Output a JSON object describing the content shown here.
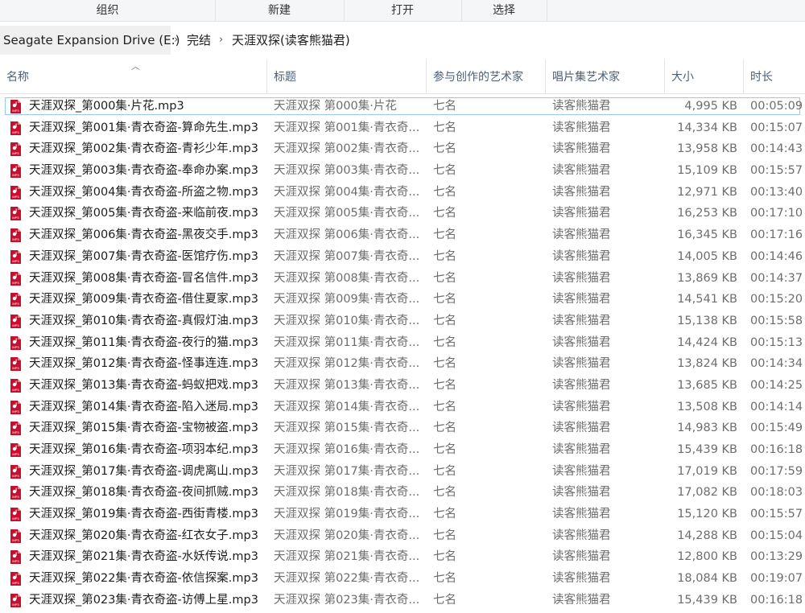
{
  "toolbar": {
    "organize": "组织",
    "new": "新建",
    "open": "打开",
    "select": "选择"
  },
  "breadcrumb": {
    "drive": "Seagate Expansion Drive (E:)",
    "folder": "完结",
    "current": "天涯双探(读客熊猫君)"
  },
  "columns": {
    "name": "名称",
    "title": "标题",
    "artist": "参与创作的艺术家",
    "album_artist": "唱片集艺术家",
    "size": "大小",
    "duration": "时长"
  },
  "icon": {
    "name": "mp3-file-icon",
    "color": "#c8102e",
    "label": "MP3"
  },
  "files": [
    {
      "name": "天涯双探_第000集·片花.mp3",
      "title": "天涯双探 第000集·片花",
      "artist": "七名",
      "album_artist": "读客熊猫君",
      "size": "4,995 KB",
      "duration": "00:05:09"
    },
    {
      "name": "天涯双探_第001集·青衣奇盗-算命先生.mp3",
      "title": "天涯双探 第001集·青衣奇...",
      "artist": "七名",
      "album_artist": "读客熊猫君",
      "size": "14,334 KB",
      "duration": "00:15:07"
    },
    {
      "name": "天涯双探_第002集·青衣奇盗-青衫少年.mp3",
      "title": "天涯双探 第002集·青衣奇...",
      "artist": "七名",
      "album_artist": "读客熊猫君",
      "size": "13,958 KB",
      "duration": "00:14:43"
    },
    {
      "name": "天涯双探_第003集·青衣奇盗-奉命办案.mp3",
      "title": "天涯双探 第003集·青衣奇...",
      "artist": "七名",
      "album_artist": "读客熊猫君",
      "size": "15,109 KB",
      "duration": "00:15:57"
    },
    {
      "name": "天涯双探_第004集·青衣奇盗-所盗之物.mp3",
      "title": "天涯双探 第004集·青衣奇...",
      "artist": "七名",
      "album_artist": "读客熊猫君",
      "size": "12,971 KB",
      "duration": "00:13:40"
    },
    {
      "name": "天涯双探_第005集·青衣奇盗-来临前夜.mp3",
      "title": "天涯双探 第005集·青衣奇...",
      "artist": "七名",
      "album_artist": "读客熊猫君",
      "size": "16,253 KB",
      "duration": "00:17:10"
    },
    {
      "name": "天涯双探_第006集·青衣奇盗-黑夜交手.mp3",
      "title": "天涯双探 第006集·青衣奇...",
      "artist": "七名",
      "album_artist": "读客熊猫君",
      "size": "16,345 KB",
      "duration": "00:17:16"
    },
    {
      "name": "天涯双探_第007集·青衣奇盗-医馆疗伤.mp3",
      "title": "天涯双探 第007集·青衣奇...",
      "artist": "七名",
      "album_artist": "读客熊猫君",
      "size": "14,005 KB",
      "duration": "00:14:46"
    },
    {
      "name": "天涯双探_第008集·青衣奇盗-冒名信件.mp3",
      "title": "天涯双探 第008集·青衣奇...",
      "artist": "七名",
      "album_artist": "读客熊猫君",
      "size": "13,869 KB",
      "duration": "00:14:37"
    },
    {
      "name": "天涯双探_第009集·青衣奇盗-借住夏家.mp3",
      "title": "天涯双探 第009集·青衣奇...",
      "artist": "七名",
      "album_artist": "读客熊猫君",
      "size": "14,541 KB",
      "duration": "00:15:20"
    },
    {
      "name": "天涯双探_第010集·青衣奇盗-真假灯油.mp3",
      "title": "天涯双探 第010集·青衣奇...",
      "artist": "七名",
      "album_artist": "读客熊猫君",
      "size": "15,138 KB",
      "duration": "00:15:58"
    },
    {
      "name": "天涯双探_第011集·青衣奇盗-夜行的猫.mp3",
      "title": "天涯双探 第011集·青衣奇...",
      "artist": "七名",
      "album_artist": "读客熊猫君",
      "size": "14,424 KB",
      "duration": "00:15:13"
    },
    {
      "name": "天涯双探_第012集·青衣奇盗-怪事连连.mp3",
      "title": "天涯双探 第012集·青衣奇...",
      "artist": "七名",
      "album_artist": "读客熊猫君",
      "size": "13,824 KB",
      "duration": "00:14:34"
    },
    {
      "name": "天涯双探_第013集·青衣奇盗-蚂蚁把戏.mp3",
      "title": "天涯双探 第013集·青衣奇...",
      "artist": "七名",
      "album_artist": "读客熊猫君",
      "size": "13,685 KB",
      "duration": "00:14:25"
    },
    {
      "name": "天涯双探_第014集·青衣奇盗-陷入迷局.mp3",
      "title": "天涯双探 第014集·青衣奇...",
      "artist": "七名",
      "album_artist": "读客熊猫君",
      "size": "13,508 KB",
      "duration": "00:14:14"
    },
    {
      "name": "天涯双探_第015集·青衣奇盗-宝物被盗.mp3",
      "title": "天涯双探 第015集·青衣奇...",
      "artist": "七名",
      "album_artist": "读客熊猫君",
      "size": "14,983 KB",
      "duration": "00:15:49"
    },
    {
      "name": "天涯双探_第016集·青衣奇盗-项羽本纪.mp3",
      "title": "天涯双探 第016集·青衣奇...",
      "artist": "七名",
      "album_artist": "读客熊猫君",
      "size": "15,439 KB",
      "duration": "00:16:18"
    },
    {
      "name": "天涯双探_第017集·青衣奇盗-调虎离山.mp3",
      "title": "天涯双探 第017集·青衣奇...",
      "artist": "七名",
      "album_artist": "读客熊猫君",
      "size": "17,019 KB",
      "duration": "00:17:59"
    },
    {
      "name": "天涯双探_第018集·青衣奇盗-夜间抓贼.mp3",
      "title": "天涯双探 第018集·青衣奇...",
      "artist": "七名",
      "album_artist": "读客熊猫君",
      "size": "17,082 KB",
      "duration": "00:18:03"
    },
    {
      "name": "天涯双探_第019集·青衣奇盗-西街青楼.mp3",
      "title": "天涯双探 第019集·青衣奇...",
      "artist": "七名",
      "album_artist": "读客熊猫君",
      "size": "15,120 KB",
      "duration": "00:15:57"
    },
    {
      "name": "天涯双探_第020集·青衣奇盗-红衣女子.mp3",
      "title": "天涯双探 第020集·青衣奇...",
      "artist": "七名",
      "album_artist": "读客熊猫君",
      "size": "14,288 KB",
      "duration": "00:15:04"
    },
    {
      "name": "天涯双探_第021集·青衣奇盗-水妖传说.mp3",
      "title": "天涯双探 第021集·青衣奇...",
      "artist": "七名",
      "album_artist": "读客熊猫君",
      "size": "12,800 KB",
      "duration": "00:13:29"
    },
    {
      "name": "天涯双探_第022集·青衣奇盗-依信探案.mp3",
      "title": "天涯双探 第022集·青衣奇...",
      "artist": "七名",
      "album_artist": "读客熊猫君",
      "size": "18,084 KB",
      "duration": "00:19:07"
    },
    {
      "name": "天涯双探_第023集·青衣奇盗-访傅上星.mp3",
      "title": "天涯双探 第023集·青衣奇...",
      "artist": "七名",
      "album_artist": "读客熊猫君",
      "size": "15,439 KB",
      "duration": "00:16:18"
    }
  ]
}
